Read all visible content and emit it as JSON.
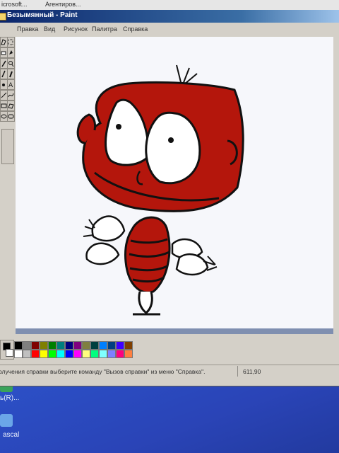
{
  "window": {
    "taskbar_left": "icrosoft...",
    "taskbar_right": "Агентиров...",
    "title": "Безымянный - Paint"
  },
  "menu": {
    "items": [
      "Правка",
      "Вид",
      "Рисунок",
      "Палитра",
      "Справка"
    ]
  },
  "status": {
    "message": "олучения справки выберите команду \"Вызов справки\" из меню \"Справка\".",
    "coords": "611,90"
  },
  "desktop": {
    "item1": "ь(R)...",
    "item2": "ascal"
  },
  "colors": {
    "drawing_fill": "#b4160c",
    "palette_row1": [
      "#000000",
      "#7f7f7f",
      "#7f0000",
      "#7f7f00",
      "#007f00",
      "#007f7f",
      "#00007f",
      "#7f007f",
      "#7f7f3f",
      "#003f3f",
      "#007fff",
      "#003f7f",
      "#3f00ff",
      "#7f3f00"
    ],
    "palette_row2": [
      "#ffffff",
      "#c0c0c0",
      "#ff0000",
      "#ffff00",
      "#00ff00",
      "#00ffff",
      "#0000ff",
      "#ff00ff",
      "#ffff7f",
      "#00ff7f",
      "#7fffff",
      "#7f7fff",
      "#ff007f",
      "#ff7f3f"
    ]
  },
  "icons": [
    "free-select-icon",
    "select-icon",
    "eraser-icon",
    "fill-icon",
    "picker-icon",
    "zoom-icon",
    "pencil-icon",
    "brush-icon",
    "airbrush-icon",
    "text-icon",
    "line-icon",
    "curve-icon",
    "rectangle-icon",
    "polygon-icon",
    "ellipse-icon",
    "rounded-rect-icon"
  ]
}
